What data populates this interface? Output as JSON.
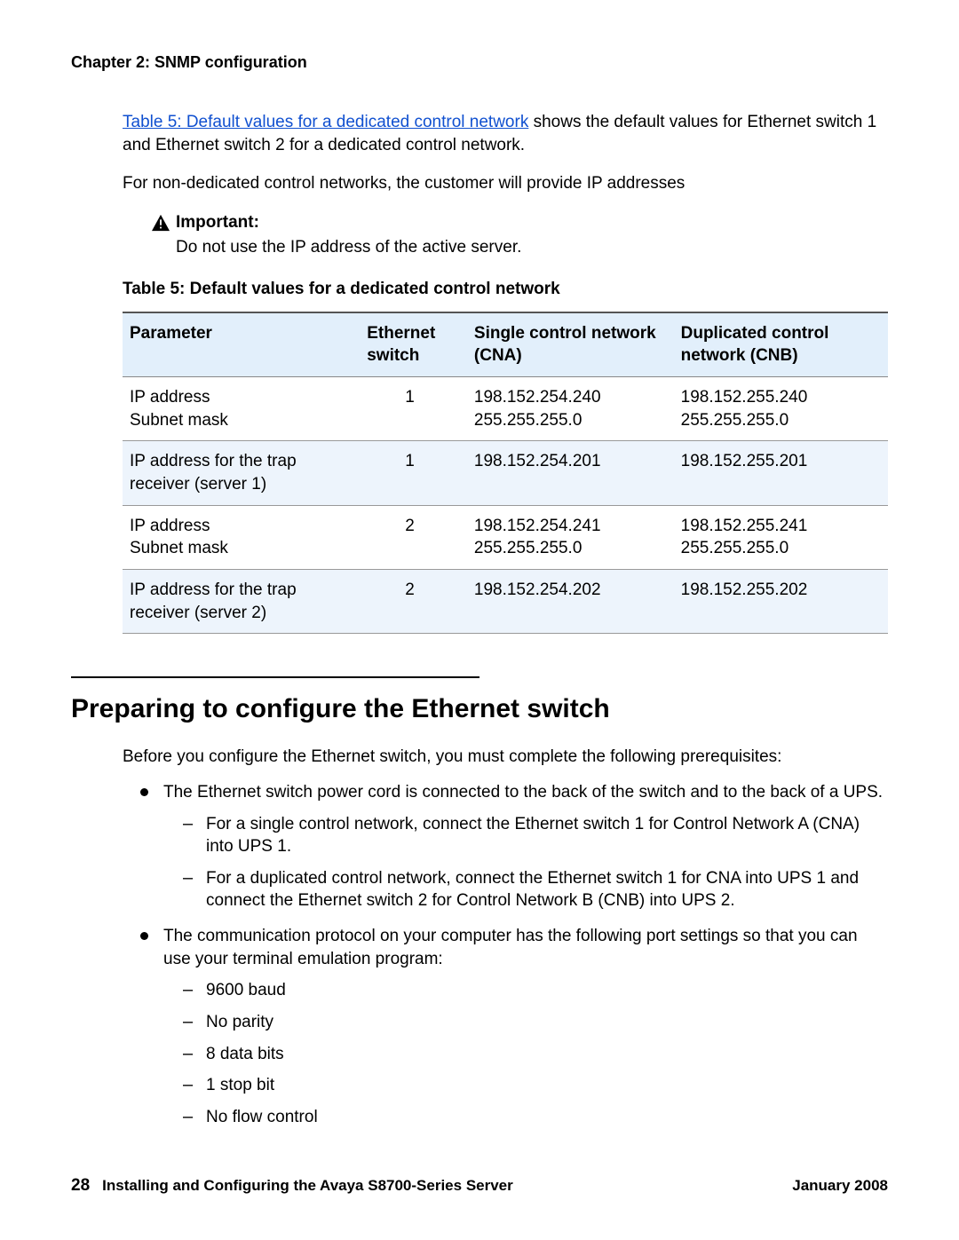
{
  "chapter_header": "Chapter 2: SNMP configuration",
  "intro": {
    "link_text": "Table 5:  Default values for a dedicated control network",
    "after_link": " shows the default values for Ethernet switch 1 and Ethernet switch 2 for a dedicated control network.",
    "para2": "For non-dedicated control networks, the customer will provide IP addresses"
  },
  "important": {
    "label": "Important:",
    "text": "Do not use the IP address of the active server."
  },
  "table": {
    "caption": "Table 5: Default values for a dedicated control network",
    "headers": {
      "param": "Parameter",
      "switch": "Ethernet switch",
      "cna": "Single control network (CNA)",
      "cnb": "Duplicated control network (CNB)"
    },
    "rows": [
      {
        "param": "IP address\nSubnet mask",
        "switch": "1",
        "cna": "198.152.254.240\n255.255.255.0",
        "cnb": "198.152.255.240\n255.255.255.0"
      },
      {
        "param": "IP address for the trap receiver (server 1)",
        "switch": "1",
        "cna": "198.152.254.201",
        "cnb": "198.152.255.201"
      },
      {
        "param": "IP address\nSubnet mask",
        "switch": "2",
        "cna": "198.152.254.241\n255.255.255.0",
        "cnb": "198.152.255.241\n255.255.255.0"
      },
      {
        "param": "IP address for the trap receiver (server 2)",
        "switch": "2",
        "cna": "198.152.254.202",
        "cnb": "198.152.255.202"
      }
    ]
  },
  "section_title": "Preparing to configure the Ethernet switch",
  "prep_intro": "Before you configure the Ethernet switch, you must complete the following prerequisites:",
  "bullets": [
    {
      "text": "The Ethernet switch power cord is connected to the back of the switch and to the back of a UPS.",
      "sub": [
        "For a single control network, connect the Ethernet switch 1 for Control Network A (CNA) into UPS 1.",
        "For a duplicated control network, connect the Ethernet switch 1 for CNA into UPS 1 and connect the Ethernet switch 2 for Control Network B (CNB) into UPS 2."
      ]
    },
    {
      "text": "The communication protocol on your computer has the following port settings so that you can use your terminal emulation program:",
      "sub": [
        "9600 baud",
        "No parity",
        "8 data bits",
        "1 stop bit",
        "No flow control"
      ]
    }
  ],
  "footer": {
    "page": "28",
    "title": "Installing and Configuring the Avaya S8700-Series Server",
    "date": "January 2008"
  }
}
